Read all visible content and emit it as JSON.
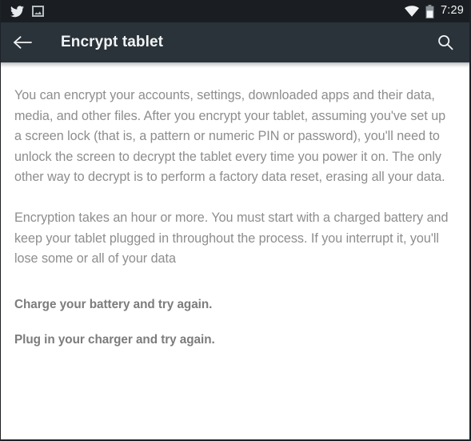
{
  "status_bar": {
    "background_color": "#1a1e22",
    "left_icons": [
      {
        "name": "twitter-icon",
        "label": "Twitter notification"
      },
      {
        "name": "screenshot-icon",
        "label": "Screenshot captured"
      }
    ],
    "right_icons": [
      {
        "name": "wifi-icon",
        "label": "Wi-Fi connected"
      },
      {
        "name": "battery-icon",
        "label": "Battery"
      }
    ],
    "clock": "7:29"
  },
  "app_bar": {
    "background_color": "#2a333a",
    "back_label": "Navigate up",
    "title": "Encrypt tablet",
    "search_label": "Search"
  },
  "content": {
    "paragraphs": [
      "You can encrypt your accounts, settings, downloaded apps and their data, media, and other files. After you encrypt your tablet, assuming you've set up a screen lock (that is, a pattern or numeric PIN or password), you'll need to unlock the screen to decrypt the tablet every time you power it on. The only other way to decrypt is to perform a factory data reset, erasing all your data.",
      "Encryption takes an hour or more. You must start with a charged battery and keep your tablet plugged in throughout the process. If you interrupt it, you'll lose some or all of your data"
    ],
    "warnings": [
      "Charge your battery and try again.",
      "Plug in your charger and try again."
    ],
    "text_color": "#8d8d8d",
    "warning_color": "#7c7c7c",
    "background_color": "#ffffff"
  }
}
